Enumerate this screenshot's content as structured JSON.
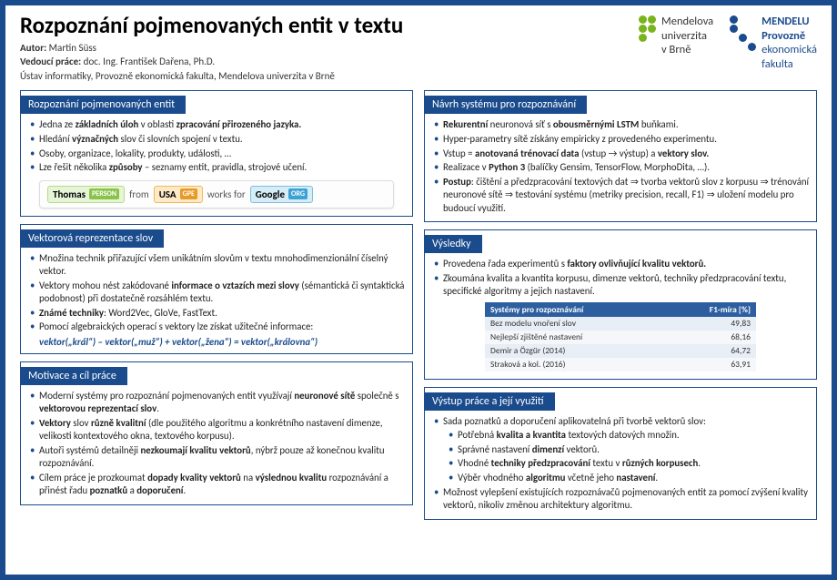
{
  "header": {
    "title": "Rozpoznání pojmenovaných entit v textu",
    "author_label": "Autor:",
    "author": "Martin Süss",
    "supervisor_label": "Vedoucí práce:",
    "supervisor": "doc. Ing. František Dařena, Ph.D.",
    "affiliation": "Ústav informatiky, Provozně ekonomická fakulta, Mendelova univerzita v Brně"
  },
  "logos": {
    "left": {
      "l1": "Mendelova",
      "l2": "univerzita",
      "l3": "v Brně"
    },
    "right": {
      "l1": "MENDELU",
      "l2": "Provozně",
      "l3": "ekonomická",
      "l4": "fakulta"
    }
  },
  "sections": {
    "ner": {
      "title": "Rozpoznání pojmenovaných entit",
      "items": [
        "Jedna ze <b>základních úloh</b> v oblasti <b>zpracování přirozeného jazyka.</b>",
        "Hledání <b>význačných</b> slov či slovních spojení v textu.",
        "Osoby, organizace, lokality, produkty, události, …",
        "Lze řešit několika <b>způsoby</b> – seznamy entit, pravidla, strojové učení."
      ],
      "example": {
        "w1": "Thomas",
        "t1": "PERSON",
        "w2": "from",
        "w3": "USA",
        "t3": "GPE",
        "w4": "works for",
        "w5": "Google",
        "t5": "ORG"
      }
    },
    "vec": {
      "title": "Vektorová reprezentace slov",
      "items": [
        "Množina technik přiřazující všem unikátním slovům v textu mnohodimenzionální číselný vektor.",
        "Vektory mohou nést zakódované <b>informace o vztazích mezi slovy</b> (sémantická či syntaktická podobnost) při dostatečně rozsáhlém textu.",
        "<b>Známé techniky</b>: Word2Vec, GloVe, FastText.",
        "Pomocí algebraických operací s vektory lze získat užitečné informace:"
      ],
      "formula": "vektor(„král“) – vektor(„muž“) + vektor(„žena“) = vektor(„královna“)"
    },
    "mot": {
      "title": "Motivace a cíl práce",
      "items": [
        "Moderní systémy pro rozpoznání pojmenovaných entit využívají <b>neuronové sítě</b> společně s <b>vektorovou reprezentací slov</b>.",
        "<b>Vektory</b> slov <b>různě kvalitní</b> (dle použitého algoritmu a konkrétního nastavení dimenze, velikosti kontextového okna, textového korpusu).",
        "Autoři systémů detailněji <b>nezkoumají kvalitu vektorů</b>, nýbrž pouze až konečnou kvalitu rozpoznávání.",
        "Cílem práce je prozkoumat <b>dopady kvality vektorů</b> na <b>výslednou kvalitu</b> rozpoznávání a přinést řadu <b>poznatků</b> a <b>doporučení</b>."
      ]
    },
    "design": {
      "title": "Návrh systému pro rozpoznávání",
      "items": [
        "<b>Rekurentní</b> neuronová síť s <b>obousměrnými LSTM</b> buňkami.",
        "Hyper-parametry sítě získány empiricky z provedeného experimentu.",
        "Vstup = <b>anotovaná trénovací data</b> (vstup → výstup) a <b>vektory slov.</b>",
        "Realizace v <b>Python 3</b> (balíčky Gensim, TensorFlow, MorphoDita, …).",
        "<b>Postup</b>: čištění a předzpracování textových dat ⇒ tvorba vektorů slov z korpusu ⇒ trénování neuronové sítě ⇒ testování systému (metriky precision, recall, F1) ⇒ uložení modelu pro budoucí využití."
      ]
    },
    "results": {
      "title": "Výsledky",
      "items": [
        "Provedena řada experimentů s <b>faktory ovlivňující kvalitu vektorů.</b>",
        "Zkoumána kvalita a kvantita korpusu, dimenze vektorů, techniky předzpracování textu, specifické algoritmy a jejich nastavení."
      ],
      "table": {
        "h1": "Systémy pro rozpoznávání",
        "h2": "F1-míra [%]",
        "rows": [
          {
            "name": "Bez modelu vnoření slov",
            "val": "49,83"
          },
          {
            "name": "Nejlepší zjištěné nastavení",
            "val": "68,16"
          },
          {
            "name": "Demir a Özgür (2014)",
            "val": "64,72"
          },
          {
            "name": "Straková a kol. (2016)",
            "val": "63,91"
          }
        ]
      }
    },
    "output": {
      "title": "Výstup práce a její využití",
      "items": [
        "Sada poznatků a doporučení aplikovatelná při tvorbě vektorů slov:"
      ],
      "sub": [
        "Potřebná <b>kvalita a kvantita</b> textových datových množin.",
        "Správné nastavení <b>dimenzí</b> vektorů.",
        "Vhodné <b>techniky předzpracování</b> textu v <b>různých korpusech</b>.",
        "Výběr vhodného <b>algoritmu</b> včetně jeho <b>nastavení</b>."
      ],
      "items2": [
        "Možnost vylepšení existujících rozpoznávačů pojmenovaných entit za pomocí zvýšení kvality vektorů, nikoliv změnou architektury algoritmu."
      ]
    }
  }
}
